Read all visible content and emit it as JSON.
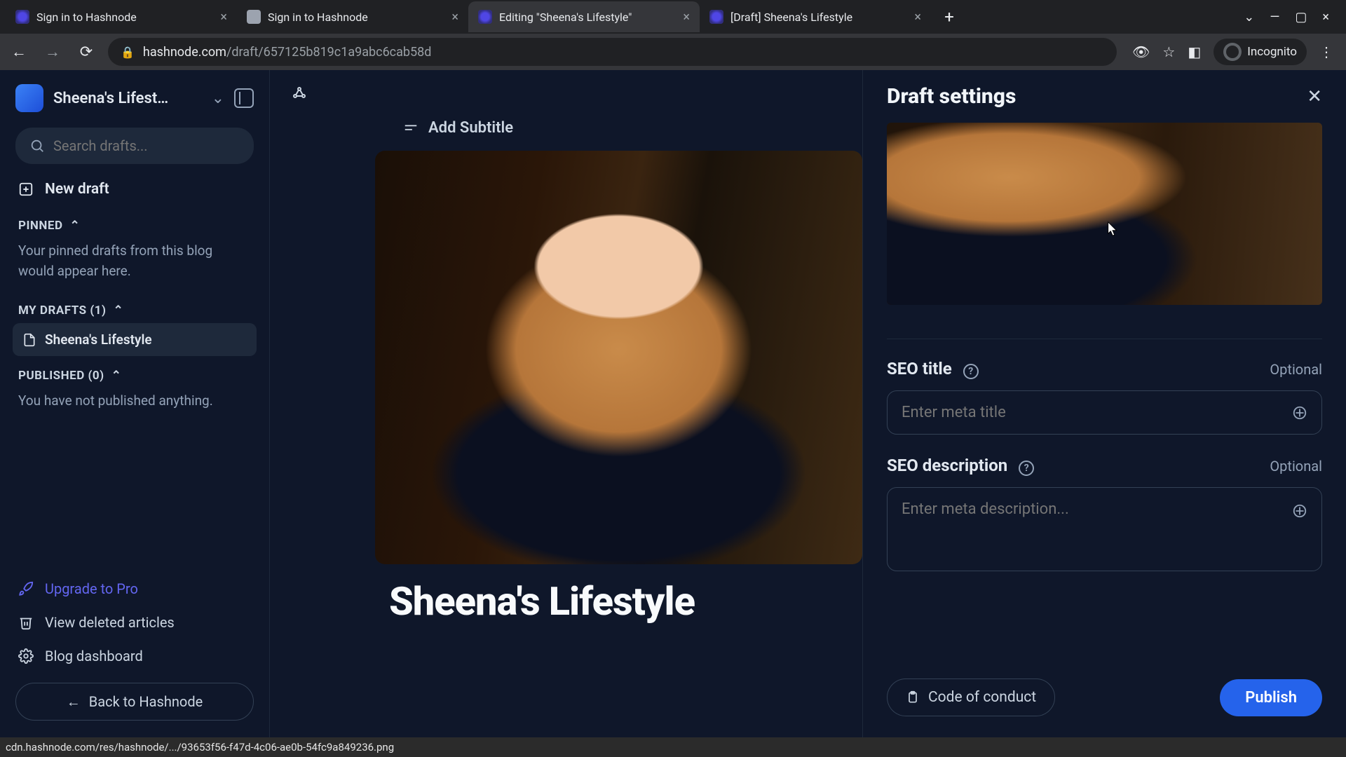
{
  "browser": {
    "tabs": [
      {
        "title": "Sign in to Hashnode",
        "active": false,
        "favicon": "blue"
      },
      {
        "title": "Sign in to Hashnode",
        "active": false,
        "favicon": "grey"
      },
      {
        "title": "Editing \"Sheena's Lifestyle\"",
        "active": true,
        "favicon": "blue"
      },
      {
        "title": "[Draft] Sheena's Lifestyle",
        "active": false,
        "favicon": "blue"
      }
    ],
    "url_host": "hashnode.com",
    "url_path": "/draft/657125b819c1a9abc6cab58d",
    "incognito_label": "Incognito"
  },
  "sidebar": {
    "blog_name": "Sheena's Lifest…",
    "search_placeholder": "Search drafts...",
    "new_draft": "New draft",
    "pinned_label": "PINNED",
    "pinned_empty": "Your pinned drafts from this blog would appear here.",
    "mydrafts_label": "MY DRAFTS (1)",
    "draft_item": "Sheena's Lifestyle",
    "published_label": "PUBLISHED (0)",
    "published_empty": "You have not published anything.",
    "upgrade": "Upgrade to Pro",
    "deleted": "View deleted articles",
    "dashboard": "Blog dashboard",
    "back": "Back to Hashnode"
  },
  "editor": {
    "add_subtitle": "Add Subtitle",
    "article_title": "Sheena's Lifestyle"
  },
  "settings": {
    "title": "Draft settings",
    "seo_title_label": "SEO title",
    "seo_title_optional": "Optional",
    "seo_title_placeholder": "Enter meta title",
    "seo_desc_label": "SEO description",
    "seo_desc_optional": "Optional",
    "seo_desc_placeholder": "Enter meta description...",
    "code_of_conduct": "Code of conduct",
    "publish": "Publish"
  },
  "status_bar": "cdn.hashnode.com/res/hashnode/.../93653f56-f47d-4c06-ae0b-54fc9a849236.png"
}
